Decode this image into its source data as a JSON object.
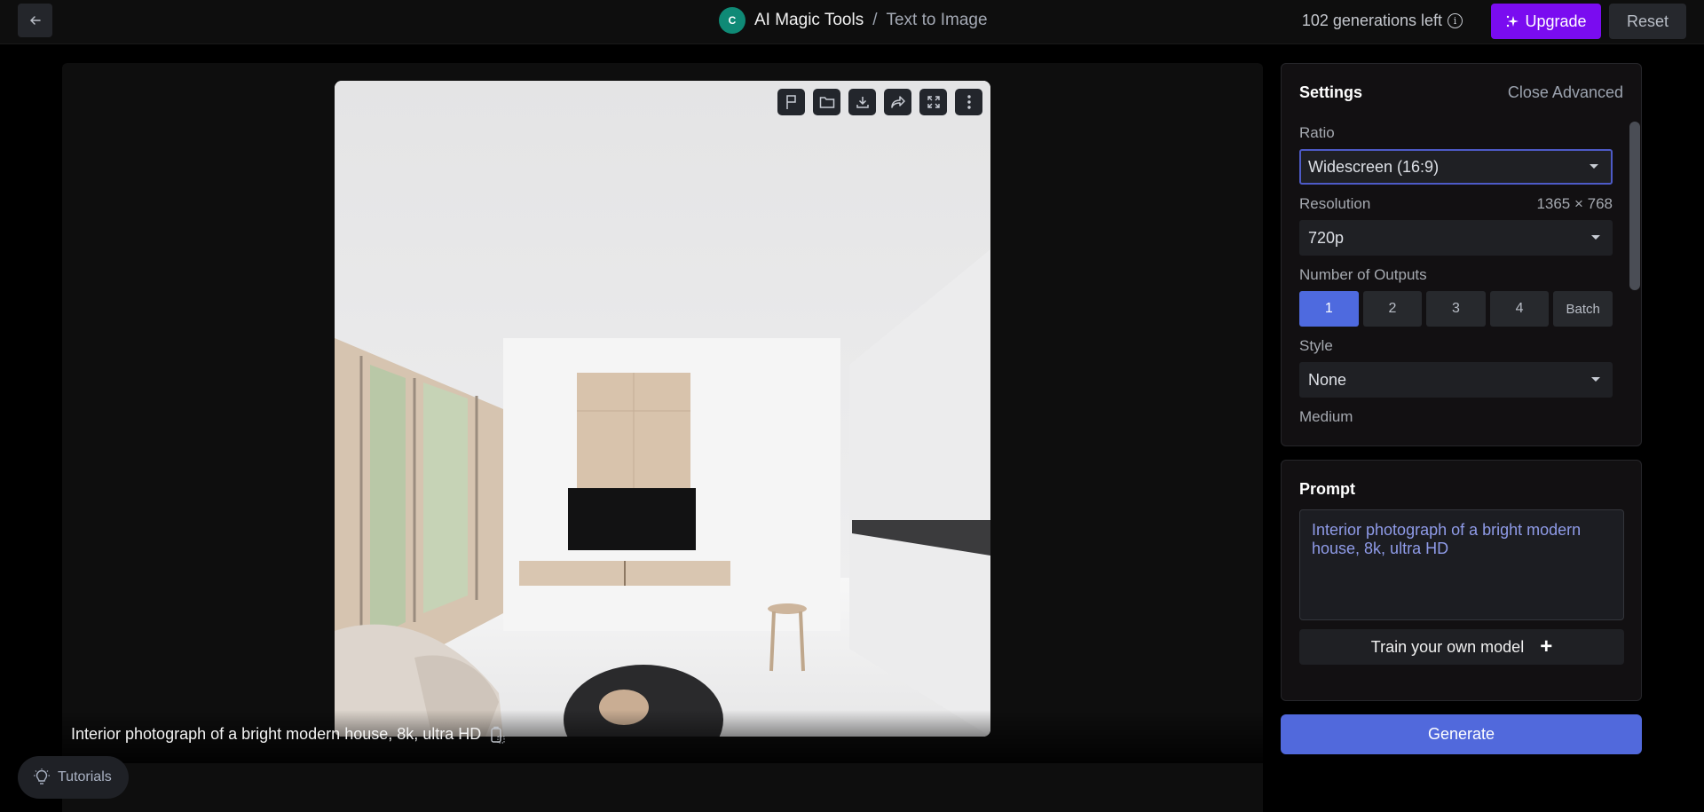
{
  "header": {
    "logo_letter": "C",
    "app_name": "AI Magic Tools",
    "separator": "/",
    "page_name": "Text to Image",
    "generations_left": "102 generations left",
    "upgrade_label": "Upgrade",
    "reset_label": "Reset"
  },
  "image": {
    "caption": "Interior photograph of a bright modern house, 8k, ultra HD",
    "toolbar": [
      "flag-icon",
      "folder-icon",
      "download-icon",
      "share-icon",
      "fullscreen-icon",
      "more-icon"
    ]
  },
  "tutorials_label": "Tutorials",
  "settings": {
    "title": "Settings",
    "close_advanced": "Close Advanced",
    "ratio_label": "Ratio",
    "ratio_value": "Widescreen (16:9)",
    "resolution_label": "Resolution",
    "resolution_dims": "1365 × 768",
    "resolution_value": "720p",
    "outputs_label": "Number of Outputs",
    "outputs": [
      "1",
      "2",
      "3",
      "4",
      "Batch"
    ],
    "outputs_selected": "1",
    "style_label": "Style",
    "style_value": "None",
    "medium_label": "Medium"
  },
  "prompt": {
    "title": "Prompt",
    "value": "Interior photograph of a bright modern house, 8k, ultra HD",
    "train_label": "Train your own model"
  },
  "generate_label": "Generate",
  "colors": {
    "accent": "#5169dc",
    "upgrade": "#7a0cf0",
    "logo": "#0f8a76",
    "prompt_text": "#8f9be8"
  }
}
